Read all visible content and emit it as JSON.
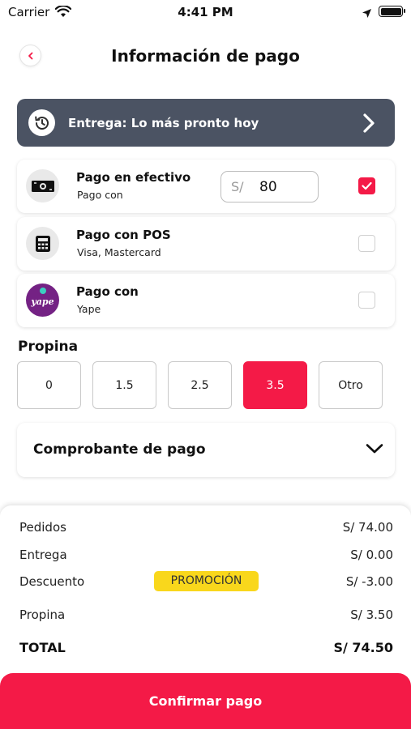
{
  "status_bar": {
    "carrier": "Carrier",
    "time": "4:41 PM",
    "icons": [
      "wifi-icon",
      "location-arrow-icon",
      "battery-icon"
    ]
  },
  "header": {
    "title": "Información de pago",
    "back_icon": "chevron-left-icon"
  },
  "delivery": {
    "label": "Entrega: Lo más pronto hoy",
    "icon": "history-clock-icon",
    "chevron_icon": "chevron-right-icon"
  },
  "payment_methods": [
    {
      "title": "Pago en efectivo",
      "subtitle": "Pago con",
      "icon": "cash-icon",
      "checked": true
    },
    {
      "title": "Pago con POS",
      "subtitle": "Visa, Mastercard",
      "icon": "calculator-pos-icon",
      "checked": false
    },
    {
      "title": "Pago con",
      "subtitle": "Yape",
      "icon": "yape-logo-icon",
      "checked": false
    }
  ],
  "cash_amount": {
    "currency": "S/",
    "value": "80"
  },
  "tip": {
    "label": "Propina",
    "options": [
      "0",
      "1.5",
      "2.5",
      "3.5",
      "Otro"
    ],
    "selected": "3.5"
  },
  "receipt": {
    "label": "Comprobante de pago",
    "icon": "chevron-down-icon"
  },
  "summary": {
    "pedidos_label": "Pedidos",
    "pedidos_value": "S/ 74.00",
    "entrega_label": "Entrega",
    "entrega_value": "S/ 0.00",
    "descuento_label": "Descuento",
    "descuento_badge": "PROMOCIÓN",
    "descuento_value": "S/ -3.00",
    "propina_label": "Propina",
    "propina_value": "S/ 3.50",
    "total_label": "TOTAL",
    "total_value": "S/ 74.50"
  },
  "confirm_button": "Confirmar pago",
  "colors": {
    "accent": "#f41a47",
    "banner": "#4b5363",
    "promo": "#f9d71c",
    "yape": "#742284"
  }
}
